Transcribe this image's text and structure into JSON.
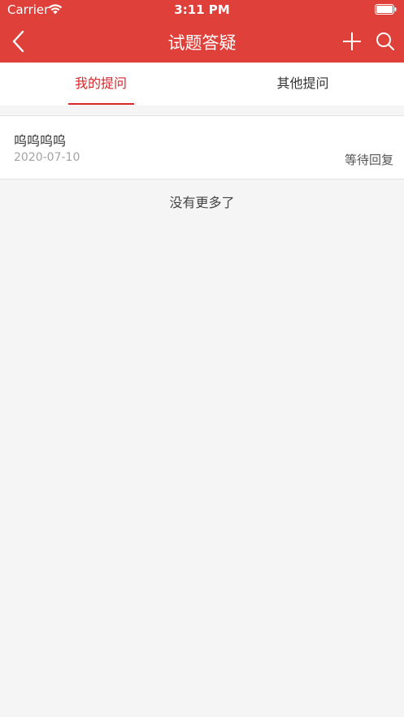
{
  "status_bar": {
    "carrier": "Carrier",
    "time": "3:11 PM"
  },
  "nav": {
    "title": "试题答疑",
    "icons": [
      "back-icon",
      "plus-icon",
      "search-icon"
    ]
  },
  "tabs": [
    {
      "label": "我的提问",
      "active": true
    },
    {
      "label": "其他提问",
      "active": false
    }
  ],
  "questions": [
    {
      "title": "呜呜呜呜",
      "date": "2020-07-10",
      "status": "等待回复"
    }
  ],
  "footer": {
    "no_more": "没有更多了"
  },
  "colors": {
    "header": "#e0403a",
    "active_tab": "#d8262c",
    "background": "#f5f5f5"
  }
}
